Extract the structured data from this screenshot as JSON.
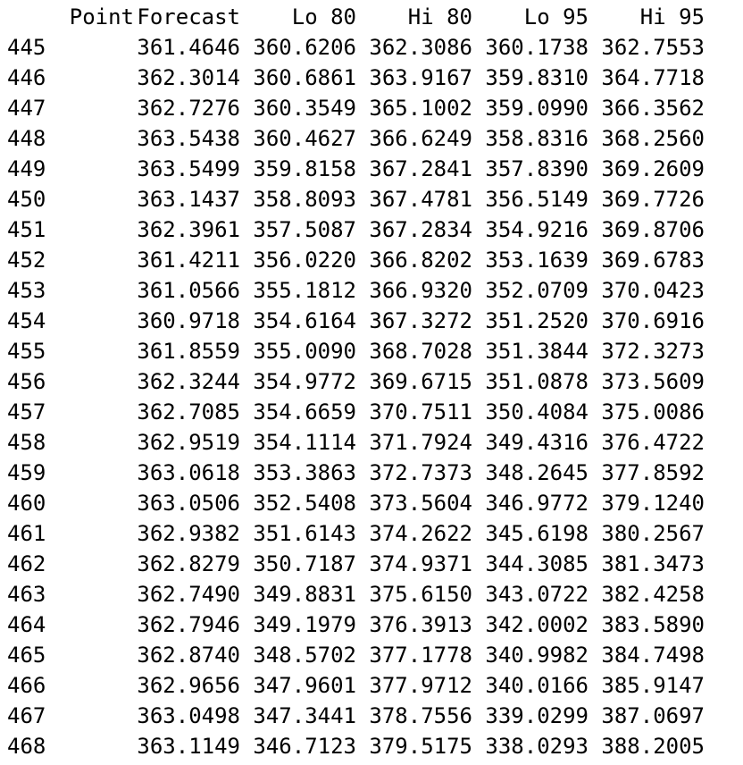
{
  "table": {
    "columns": [
      "Point",
      "Forecast",
      "Lo 80",
      "Hi 80",
      "Lo 95",
      "Hi 95"
    ],
    "rows": [
      {
        "point": "445",
        "forecast": "361.4646",
        "lo80": "360.6206",
        "hi80": "362.3086",
        "lo95": "360.1738",
        "hi95": "362.7553"
      },
      {
        "point": "446",
        "forecast": "362.3014",
        "lo80": "360.6861",
        "hi80": "363.9167",
        "lo95": "359.8310",
        "hi95": "364.7718"
      },
      {
        "point": "447",
        "forecast": "362.7276",
        "lo80": "360.3549",
        "hi80": "365.1002",
        "lo95": "359.0990",
        "hi95": "366.3562"
      },
      {
        "point": "448",
        "forecast": "363.5438",
        "lo80": "360.4627",
        "hi80": "366.6249",
        "lo95": "358.8316",
        "hi95": "368.2560"
      },
      {
        "point": "449",
        "forecast": "363.5499",
        "lo80": "359.8158",
        "hi80": "367.2841",
        "lo95": "357.8390",
        "hi95": "369.2609"
      },
      {
        "point": "450",
        "forecast": "363.1437",
        "lo80": "358.8093",
        "hi80": "367.4781",
        "lo95": "356.5149",
        "hi95": "369.7726"
      },
      {
        "point": "451",
        "forecast": "362.3961",
        "lo80": "357.5087",
        "hi80": "367.2834",
        "lo95": "354.9216",
        "hi95": "369.8706"
      },
      {
        "point": "452",
        "forecast": "361.4211",
        "lo80": "356.0220",
        "hi80": "366.8202",
        "lo95": "353.1639",
        "hi95": "369.6783"
      },
      {
        "point": "453",
        "forecast": "361.0566",
        "lo80": "355.1812",
        "hi80": "366.9320",
        "lo95": "352.0709",
        "hi95": "370.0423"
      },
      {
        "point": "454",
        "forecast": "360.9718",
        "lo80": "354.6164",
        "hi80": "367.3272",
        "lo95": "351.2520",
        "hi95": "370.6916"
      },
      {
        "point": "455",
        "forecast": "361.8559",
        "lo80": "355.0090",
        "hi80": "368.7028",
        "lo95": "351.3844",
        "hi95": "372.3273"
      },
      {
        "point": "456",
        "forecast": "362.3244",
        "lo80": "354.9772",
        "hi80": "369.6715",
        "lo95": "351.0878",
        "hi95": "373.5609"
      },
      {
        "point": "457",
        "forecast": "362.7085",
        "lo80": "354.6659",
        "hi80": "370.7511",
        "lo95": "350.4084",
        "hi95": "375.0086"
      },
      {
        "point": "458",
        "forecast": "362.9519",
        "lo80": "354.1114",
        "hi80": "371.7924",
        "lo95": "349.4316",
        "hi95": "376.4722"
      },
      {
        "point": "459",
        "forecast": "363.0618",
        "lo80": "353.3863",
        "hi80": "372.7373",
        "lo95": "348.2645",
        "hi95": "377.8592"
      },
      {
        "point": "460",
        "forecast": "363.0506",
        "lo80": "352.5408",
        "hi80": "373.5604",
        "lo95": "346.9772",
        "hi95": "379.1240"
      },
      {
        "point": "461",
        "forecast": "362.9382",
        "lo80": "351.6143",
        "hi80": "374.2622",
        "lo95": "345.6198",
        "hi95": "380.2567"
      },
      {
        "point": "462",
        "forecast": "362.8279",
        "lo80": "350.7187",
        "hi80": "374.9371",
        "lo95": "344.3085",
        "hi95": "381.3473"
      },
      {
        "point": "463",
        "forecast": "362.7490",
        "lo80": "349.8831",
        "hi80": "375.6150",
        "lo95": "343.0722",
        "hi95": "382.4258"
      },
      {
        "point": "464",
        "forecast": "362.7946",
        "lo80": "349.1979",
        "hi80": "376.3913",
        "lo95": "342.0002",
        "hi95": "383.5890"
      },
      {
        "point": "465",
        "forecast": "362.8740",
        "lo80": "348.5702",
        "hi80": "377.1778",
        "lo95": "340.9982",
        "hi95": "384.7498"
      },
      {
        "point": "466",
        "forecast": "362.9656",
        "lo80": "347.9601",
        "hi80": "377.9712",
        "lo95": "340.0166",
        "hi95": "385.9147"
      },
      {
        "point": "467",
        "forecast": "363.0498",
        "lo80": "347.3441",
        "hi80": "378.7556",
        "lo95": "339.0299",
        "hi95": "387.0697"
      },
      {
        "point": "468",
        "forecast": "363.1149",
        "lo80": "346.7123",
        "hi80": "379.5175",
        "lo95": "338.0293",
        "hi95": "388.2005"
      }
    ]
  }
}
